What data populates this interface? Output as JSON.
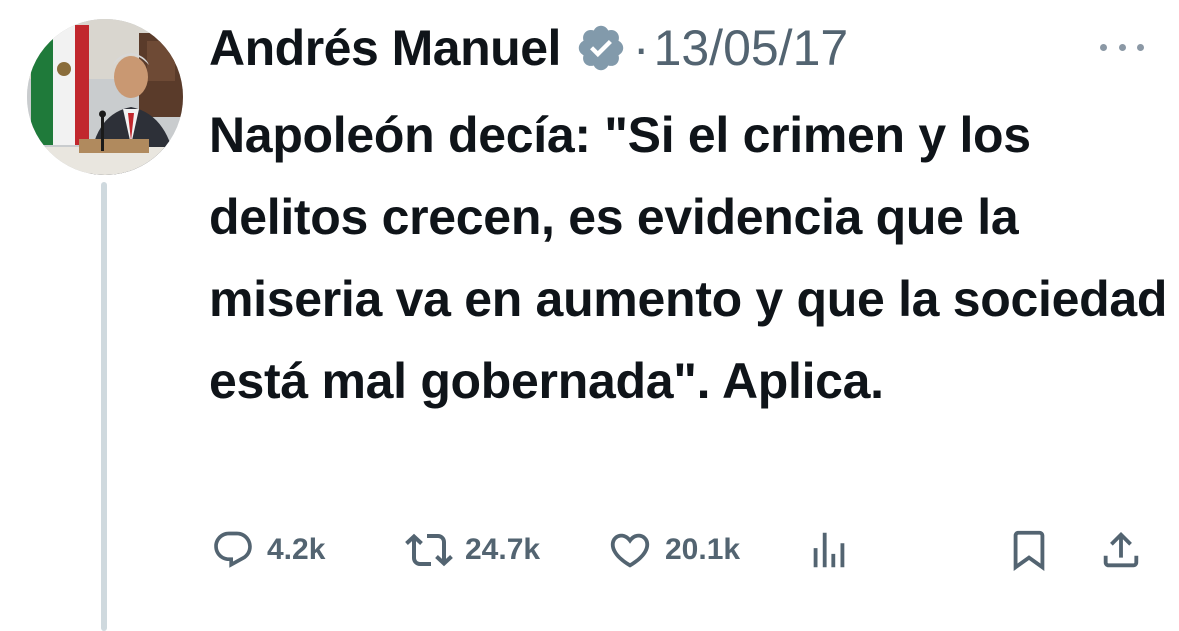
{
  "author": {
    "display_name": "Andrés Manuel",
    "verified": true,
    "separator": "·",
    "date": "13/05/17"
  },
  "tweet": {
    "text": "Napoleón decía: \"Si el crimen y los delitos crecen, es evidencia que la miseria va en aumento y que la sociedad está mal gobernada\". Aplica."
  },
  "actions": {
    "replies": "4.2k",
    "reposts": "24.7k",
    "likes": "20.1k"
  },
  "icons": {
    "verified": "verified-badge-icon",
    "reply": "reply-icon",
    "repost": "repost-icon",
    "like": "heart-icon",
    "views": "views-icon",
    "bookmark": "bookmark-icon",
    "share": "share-icon",
    "more": "more-icon"
  },
  "colors": {
    "text": "#0f1419",
    "secondary": "#536471",
    "thread_line": "#cfd9de",
    "verified_badge": "#829aab"
  }
}
